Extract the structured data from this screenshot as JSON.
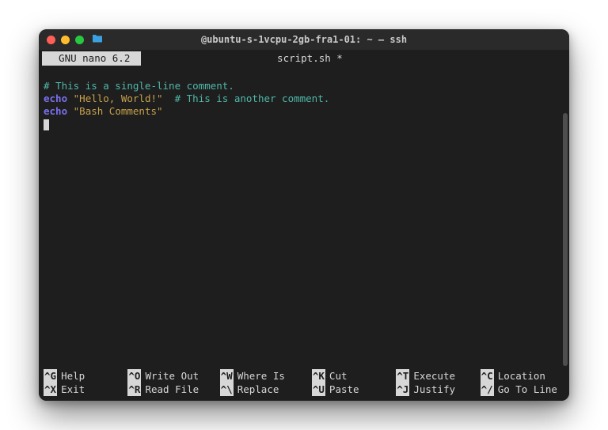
{
  "window": {
    "title": "@ubuntu-s-1vcpu-2gb-fra1-01: ~ — ssh"
  },
  "nano": {
    "app": "  GNU nano 6.2 ",
    "filename": "script.sh *"
  },
  "code": {
    "comment1": "# This is a single-line comment.",
    "echo1_cmd": "echo",
    "echo1_str": "\"Hello, World!\"",
    "comment2": "  # This is another comment.",
    "echo2_cmd": "echo",
    "echo2_str": "\"Bash Comments\""
  },
  "shortcuts": {
    "row1": [
      {
        "key": "^G",
        "label": "Help"
      },
      {
        "key": "^O",
        "label": "Write Out"
      },
      {
        "key": "^W",
        "label": "Where Is"
      },
      {
        "key": "^K",
        "label": "Cut"
      },
      {
        "key": "^T",
        "label": "Execute"
      },
      {
        "key": "^C",
        "label": "Location"
      }
    ],
    "row2": [
      {
        "key": "^X",
        "label": "Exit"
      },
      {
        "key": "^R",
        "label": "Read File"
      },
      {
        "key": "^\\",
        "label": "Replace"
      },
      {
        "key": "^U",
        "label": "Paste"
      },
      {
        "key": "^J",
        "label": "Justify"
      },
      {
        "key": "^/",
        "label": "Go To Line"
      }
    ]
  }
}
